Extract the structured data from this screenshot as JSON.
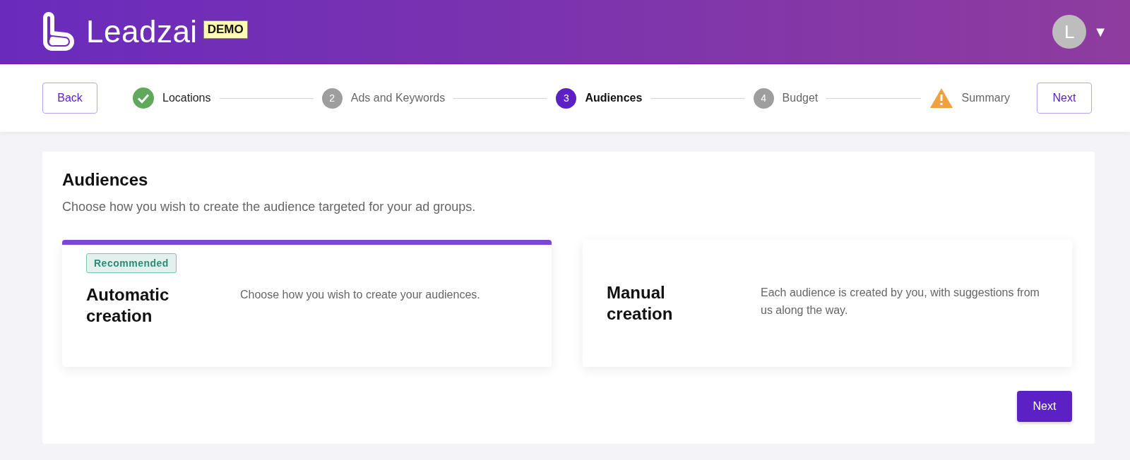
{
  "header": {
    "brand": "Leadzai",
    "badge": "DEMO",
    "avatar": "L",
    "menu_caret": "▼"
  },
  "stepper": {
    "back": "Back",
    "next": "Next",
    "steps": [
      {
        "kind": "done",
        "label": "Locations",
        "selected": false
      },
      {
        "kind": "number",
        "number": "2",
        "label": "Ads and Keywords",
        "selected": false
      },
      {
        "kind": "number",
        "number": "3",
        "label": "Audiences",
        "selected": true
      },
      {
        "kind": "number",
        "number": "4",
        "label": "Budget",
        "selected": false
      },
      {
        "kind": "warning",
        "label": "Summary",
        "selected": false
      }
    ]
  },
  "content": {
    "title": "Audiences",
    "subtitle": "Choose how you wish to create the audience targeted for your ad groups.",
    "options": [
      {
        "badge": "Recommended",
        "title": "Automatic creation",
        "description": "Choose how you wish to create your audiences.",
        "selected": true
      },
      {
        "title": "Manual creation",
        "description": "Each audience is created by you, with suggestions from us along the way.",
        "selected": false
      }
    ],
    "next": "Next"
  }
}
